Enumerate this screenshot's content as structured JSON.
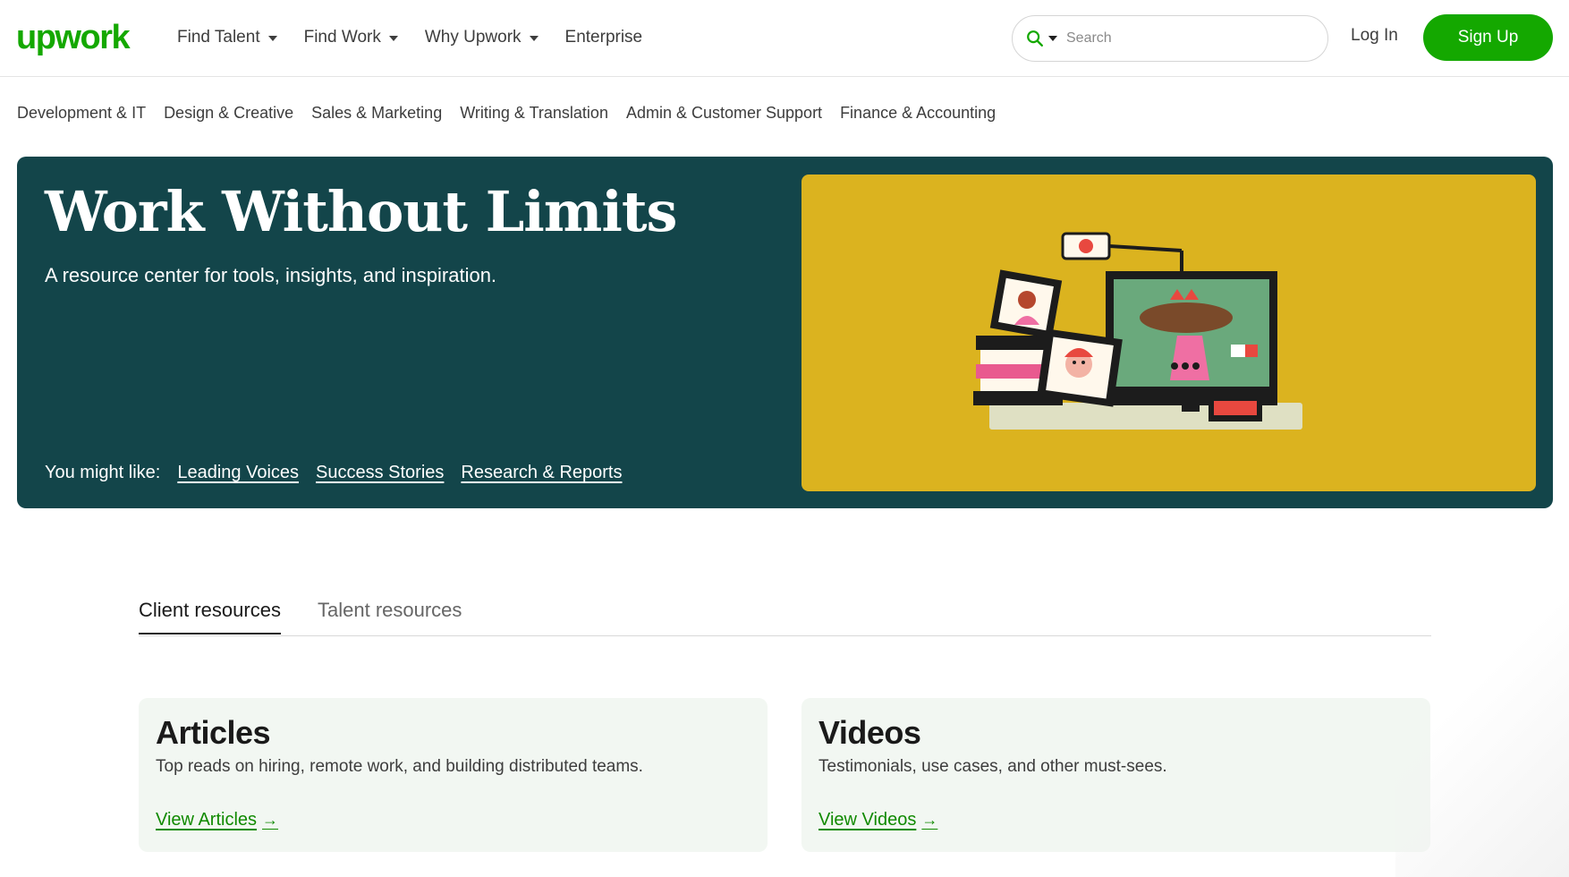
{
  "header": {
    "logo": "upwork",
    "nav": [
      {
        "label": "Find Talent",
        "has_dropdown": true
      },
      {
        "label": "Find Work",
        "has_dropdown": true
      },
      {
        "label": "Why Upwork",
        "has_dropdown": true
      },
      {
        "label": "Enterprise",
        "has_dropdown": false
      }
    ],
    "search": {
      "placeholder": "Search",
      "value": ""
    },
    "login_label": "Log In",
    "signup_label": "Sign Up"
  },
  "categories": [
    "Development & IT",
    "Design & Creative",
    "Sales & Marketing",
    "Writing & Translation",
    "Admin & Customer Support",
    "Finance & Accounting"
  ],
  "hero": {
    "title": "Work Without Limits",
    "subtitle": "A resource center for tools, insights, and inspiration.",
    "you_might_like_label": "You might like:",
    "links": [
      "Leading Voices",
      "Success Stories",
      "Research & Reports"
    ]
  },
  "tabs": {
    "active": "Client resources",
    "inactive": "Talent resources"
  },
  "cards": [
    {
      "title": "Articles",
      "description": "Top reads on hiring, remote work, and building distributed teams.",
      "link": "View Articles"
    },
    {
      "title": "Videos",
      "description": "Testimonials, use cases, and other must-sees.",
      "link": "View Videos"
    }
  ],
  "colors": {
    "brand_green": "#14a800",
    "hero_bg": "#13454a",
    "illustration_bg": "#dbb31f",
    "card_bg": "#f2f7f2"
  },
  "icons": {
    "search": "search-icon",
    "caret": "chevron-down-icon",
    "arrow": "arrow-right-icon"
  }
}
